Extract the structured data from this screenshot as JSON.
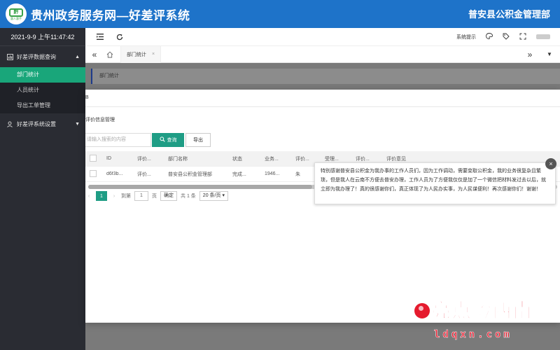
{
  "header": {
    "logo_text": "黔",
    "logo_tagline": "惠人惠手",
    "app_title": "贵州政务服务网—好差评系统",
    "org_name": "普安县公积金管理部"
  },
  "sidebar": {
    "clock": "2021-9-9 上午11:47:42",
    "groups": [
      {
        "label": "好差评数据查询",
        "expanded": true,
        "items": [
          {
            "label": "部门统计",
            "active": true
          },
          {
            "label": "人员统计",
            "active": false
          },
          {
            "label": "导出工单管理",
            "active": false
          }
        ]
      },
      {
        "label": "好差评系统设置",
        "expanded": false,
        "items": []
      }
    ]
  },
  "toolbar": {
    "system_tip": "系统提示"
  },
  "tabs": {
    "items": [
      {
        "label": "部门统计",
        "closable": true
      }
    ]
  },
  "page": {
    "breadcrumb": "部门统计"
  },
  "modal": {
    "header_char": "B",
    "section_title": "评价信息管理",
    "search_placeholder": "请输入搜索的内容",
    "search_button": "查询",
    "export_button": "导出",
    "table": {
      "columns": [
        "ID",
        "评价...",
        "部门名称",
        "状态",
        "业务...",
        "评价...",
        "受理...",
        "评价...",
        "评价意见"
      ],
      "rows": [
        [
          "d6f3b...",
          "评价...",
          "普安县公积金管理部",
          "完成...",
          "1946...",
          "朱",
          "",
          "",
          ""
        ]
      ]
    },
    "pager": {
      "current_page": "1",
      "goto_label": "到第",
      "goto_value": "1",
      "page_unit": "页",
      "confirm": "确定",
      "total": "共 1 条",
      "page_size": "20 条/页"
    }
  },
  "tooltip": {
    "text": "特别感谢普安县公积金为我办事的工作人员们，因为工作调动，需要变取公积金，我的业务很复杂且繁琐，但是我人在云南不方便去普安办理，工作人员为了方便我仅仅是加了一个微信把材料发过去以后，就立即为我办理了！真的很感谢你们，真正体现了为人民办实事，为人民谋便利！再次感谢你们！谢谢！"
  },
  "watermark": {
    "title": "亮点黔西南",
    "url": "ldqxn.com"
  },
  "colors": {
    "banner": "#1e73c9",
    "sidebar": "#2a2c33",
    "accent": "#1f9d85",
    "active_menu": "#19a67a",
    "watermark": "#e51a2d"
  }
}
